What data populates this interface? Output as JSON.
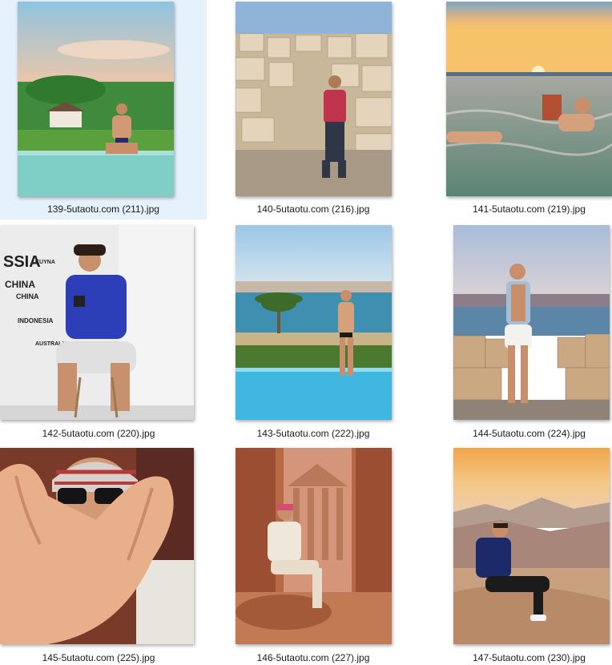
{
  "files": [
    {
      "name": "139-5utaotu.com (211).jpg",
      "selected": true,
      "scene": "hillside-infinity-pool"
    },
    {
      "name": "140-5utaotu.com (216).jpg",
      "selected": false,
      "scene": "city-overlook"
    },
    {
      "name": "141-5utaotu.com (219).jpg",
      "selected": false,
      "scene": "sunset-sea-reading"
    },
    {
      "name": "142-5utaotu.com (220).jpg",
      "selected": false,
      "scene": "indoor-stool-camera"
    },
    {
      "name": "143-5utaotu.com (222).jpg",
      "selected": false,
      "scene": "palm-pool-sea"
    },
    {
      "name": "144-5utaotu.com (224).jpg",
      "selected": false,
      "scene": "rooftop-harbor-view"
    },
    {
      "name": "145-5utaotu.com (225).jpg",
      "selected": false,
      "scene": "hand-closeup-headscarf"
    },
    {
      "name": "146-5utaotu.com (227).jpg",
      "selected": false,
      "scene": "petra-treasury"
    },
    {
      "name": "147-5utaotu.com (230).jpg",
      "selected": false,
      "scene": "desert-mountain-sunset"
    }
  ]
}
